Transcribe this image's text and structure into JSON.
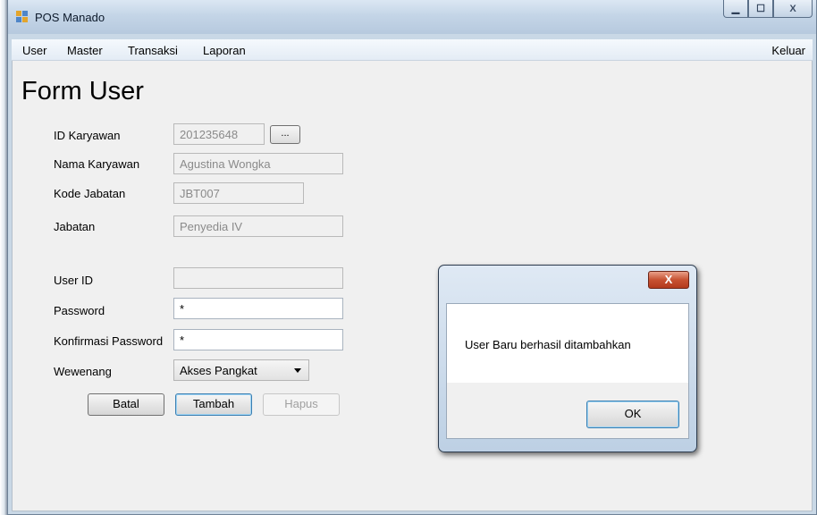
{
  "window": {
    "title": "POS Manado",
    "controls": {
      "minimize": "▁",
      "maximize": "☐",
      "close": "X"
    }
  },
  "menu": {
    "items": [
      "User",
      "Master",
      "Transaksi",
      "Laporan"
    ],
    "exit": "Keluar"
  },
  "form": {
    "title": "Form User",
    "fields": {
      "id_karyawan": {
        "label": "ID Karyawan",
        "value": "201235648"
      },
      "nama_karyawan": {
        "label": "Nama Karyawan",
        "value": "Agustina Wongka"
      },
      "kode_jabatan": {
        "label": "Kode Jabatan",
        "value": "JBT007"
      },
      "jabatan": {
        "label": "Jabatan",
        "value": "Penyedia IV"
      },
      "user_id": {
        "label": "User ID",
        "value": ""
      },
      "password": {
        "label": "Password",
        "value": "*"
      },
      "konfirmasi_password": {
        "label": "Konfirmasi Password",
        "value": "*"
      },
      "wewenang": {
        "label": "Wewenang",
        "value": "Akses Pangkat"
      }
    },
    "browse_button": "...",
    "buttons": {
      "batal": "Batal",
      "tambah": "Tambah",
      "hapus": "Hapus"
    }
  },
  "dialog": {
    "close": "X",
    "message": "User Baru berhasil ditambahkan",
    "ok": "OK"
  }
}
